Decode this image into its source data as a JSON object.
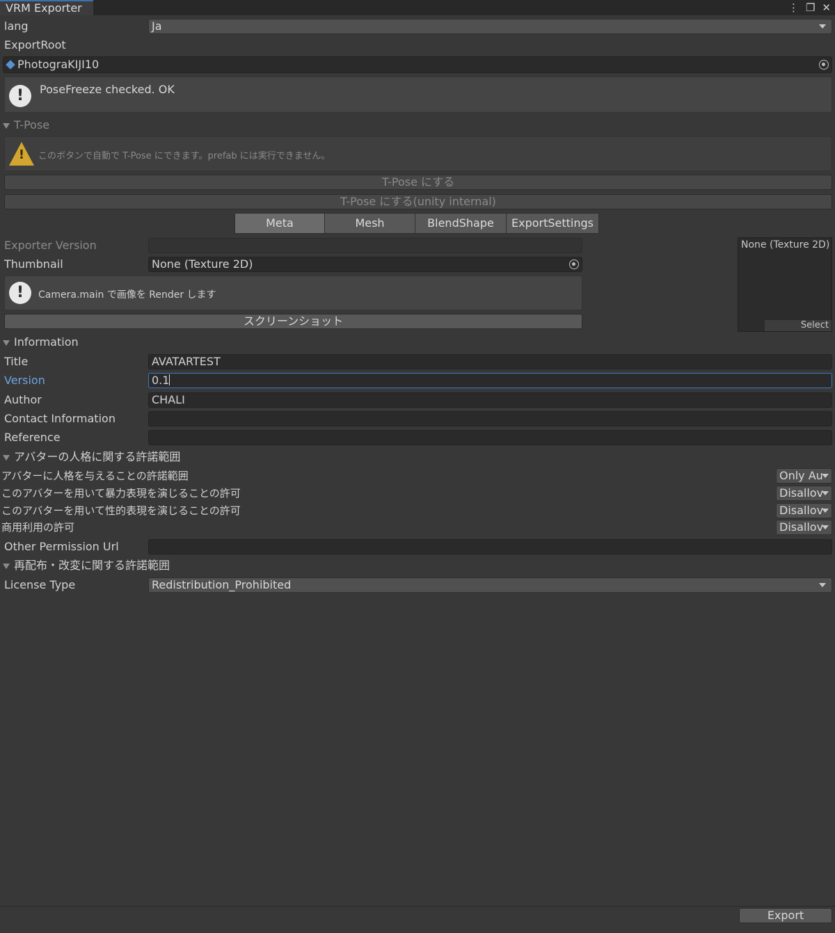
{
  "window": {
    "tab_title": "VRM Exporter",
    "menu_icon": "⋮",
    "maximize_icon": "❐",
    "close_icon": "✕"
  },
  "lang": {
    "label": "lang",
    "value": "Ja"
  },
  "export_root": {
    "label": "ExportRoot",
    "value": "PhotograKIJI10",
    "icon": "prefab-cube-icon"
  },
  "posefreeze_msg": "PoseFreeze checked. OK",
  "tpose": {
    "header": "T-Pose",
    "warning": "このボタンで自動で T-Pose にできます。prefab には実行できません。",
    "button1": "T-Pose にする",
    "button2": "T-Pose にする(unity internal)"
  },
  "tabs": [
    {
      "label": "Meta"
    },
    {
      "label": "Mesh"
    },
    {
      "label": "BlendShape"
    },
    {
      "label": "ExportSettings"
    }
  ],
  "meta": {
    "exporter_version_label": "Exporter Version",
    "exporter_version_value": "",
    "thumbnail_label": "Thumbnail",
    "thumbnail_value": "None (Texture 2D)",
    "camera_msg": "Camera.main で画像を Render します",
    "screenshot_button": "スクリーンショット",
    "preview_label": "None (Texture 2D)",
    "preview_select": "Select"
  },
  "information": {
    "header": "Information",
    "title_label": "Title",
    "title_value": "AVATARTEST",
    "version_label": "Version",
    "version_value": "0.1",
    "author_label": "Author",
    "author_value": "CHALI",
    "contact_label": "Contact Information",
    "contact_value": "",
    "reference_label": "Reference",
    "reference_value": ""
  },
  "permission": {
    "header": "アバターの人格に関する許諾範囲",
    "rows": [
      {
        "label": "アバターに人格を与えることの許諾範囲",
        "value": "Only Au"
      },
      {
        "label": "このアバターを用いて暴力表現を演じることの許可",
        "value": "Disallov"
      },
      {
        "label": "このアバターを用いて性的表現を演じることの許可",
        "value": "Disallov"
      },
      {
        "label": "商用利用の許可",
        "value": "Disallov"
      }
    ],
    "other_url_label": "Other Permission Url",
    "other_url_value": ""
  },
  "redistribution": {
    "header": "再配布・改変に関する許諾範囲",
    "license_label": "License Type",
    "license_value": "Redistribution_Prohibited"
  },
  "footer": {
    "export_button": "Export"
  }
}
